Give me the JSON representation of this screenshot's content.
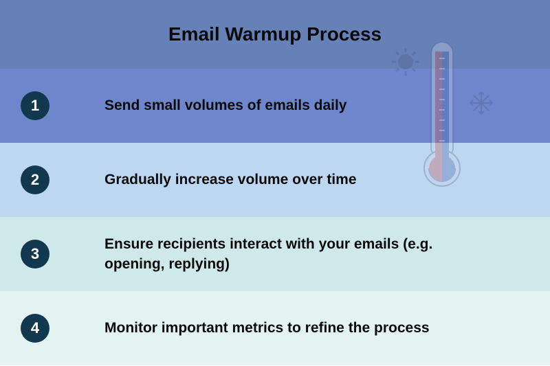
{
  "title": "Email Warmup Process",
  "steps": [
    {
      "num": "1",
      "text": "Send small volumes of emails daily"
    },
    {
      "num": "2",
      "text": "Gradually increase volume over time"
    },
    {
      "num": "3",
      "text": "Ensure recipients interact with your emails (e.g. opening, replying)"
    },
    {
      "num": "4",
      "text": "Monitor important metrics to refine the process"
    }
  ]
}
